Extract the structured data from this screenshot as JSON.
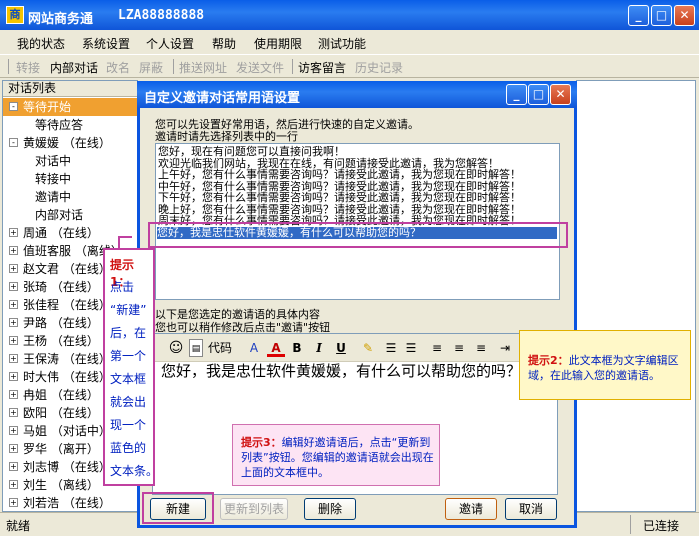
{
  "window": {
    "title": "网站商务通",
    "account": "LZA88888888",
    "icon_letter": "商"
  },
  "menu": [
    "我的状态",
    "系统设置",
    "个人设置",
    "帮助",
    "使用期限",
    "测试功能"
  ],
  "toolbar": {
    "transfer": "转接",
    "internal_chat": "内部对话",
    "rename": "改名",
    "block": "屏蔽",
    "push_url": "推送网址",
    "send_file": "发送文件",
    "visitor_msg": "访客留言",
    "history": "历史记录"
  },
  "left_panel": {
    "header": "对话列表",
    "rows": [
      {
        "exp": "-",
        "label": "等待开始",
        "kind": "sel"
      },
      {
        "exp": "",
        "label": "等待应答",
        "kind": "sub"
      },
      {
        "exp": "-",
        "label": "黄媛媛 （在线）",
        "kind": "sub"
      },
      {
        "exp": "",
        "label": "对话中",
        "kind": "sub"
      },
      {
        "exp": "",
        "label": "转接中",
        "kind": "sub"
      },
      {
        "exp": "",
        "label": "邀请中",
        "kind": "sub"
      },
      {
        "exp": "",
        "label": "内部对话",
        "kind": "sub"
      },
      {
        "exp": "+",
        "label": "周通 （在线）",
        "kind": "sub"
      },
      {
        "exp": "+",
        "label": "值班客服 （离线）",
        "kind": "sub"
      },
      {
        "exp": "+",
        "label": "赵文君 （在线）",
        "kind": "sub"
      },
      {
        "exp": "+",
        "label": "张琦 （在线）",
        "kind": "sub"
      },
      {
        "exp": "+",
        "label": "张佳程 （在线）",
        "kind": "sub"
      },
      {
        "exp": "+",
        "label": "尹路 （在线）",
        "kind": "sub"
      },
      {
        "exp": "+",
        "label": "王杨 （在线）",
        "kind": "sub"
      },
      {
        "exp": "+",
        "label": "王保涛 （在线）",
        "kind": "sub"
      },
      {
        "exp": "+",
        "label": "时大伟 （在线）",
        "kind": "sub"
      },
      {
        "exp": "+",
        "label": "冉姐 （在线）",
        "kind": "sub"
      },
      {
        "exp": "+",
        "label": "欧阳 （在线）",
        "kind": "sub"
      },
      {
        "exp": "+",
        "label": "马姐 （对话中）",
        "kind": "sub"
      },
      {
        "exp": "+",
        "label": "罗华 （离开）",
        "kind": "sub"
      },
      {
        "exp": "+",
        "label": "刘志博 （在线）",
        "kind": "sub"
      },
      {
        "exp": "+",
        "label": "刘生 （离线）",
        "kind": "sub"
      },
      {
        "exp": "+",
        "label": "刘若浩 （在线）",
        "kind": "sub"
      }
    ]
  },
  "status": {
    "left": "就绪",
    "right": "已连接"
  },
  "dialog": {
    "title": "自定义邀请对话常用语设置",
    "desc1": "您可以先设置好常用语，然后进行快速的自定义邀请。",
    "desc2": "邀请时请先选择列表中的一行",
    "list": [
      "您好，现在有问题您可以直接问我啊！",
      "欢迎光临我们网站，我现在在线，有问题请接受此邀请，我为您解答！",
      "上午好，您有什么事情需要咨询吗？请接受此邀请，我为您现在即时解答！",
      "中午好，您有什么事情需要咨询吗？请接受此邀请，我为您现在即时解答！",
      "下午好，您有什么事情需要咨询吗？请接受此邀请，我为您现在即时解答！",
      "晚上好，您有什么事情需要咨询吗？请接受此邀请，我为您现在即时解答！",
      "周末好，您有什么事情需要咨询吗？请接受此邀请，我为您现在即时解答！",
      "您好，我是忠仕软件黄媛媛，有什么可以帮助您的吗？"
    ],
    "selected_index": 7,
    "below1": "以下是您选定的邀请语的具体内容",
    "below2": "您也可以稍作修改后点击\"邀请\"按钮",
    "editor_code_label": "代码",
    "editor_text": "您好，我是忠仕软件黄媛媛，有什么可以帮助您的吗？",
    "buttons": {
      "new": "新建",
      "update": "更新到列表",
      "delete": "删除",
      "invite": "邀请",
      "cancel": "取消"
    }
  },
  "tips": {
    "tip1_title": "提示1：",
    "tip1_lines": [
      "点击",
      "“新建”",
      "后，在",
      "第一个",
      "文本框",
      "就会出",
      "现一个",
      "蓝色的",
      "文本条。"
    ],
    "tip2_title": "提示2：",
    "tip2_body": "此文本框为文字编辑区域，在此输入您的邀请语。",
    "tip3_title": "提示3：",
    "tip3_body": "编辑好邀请语后，点击“更新到列表”按钮。您编辑的邀请语就会出现在上面的文本框中。"
  },
  "colors": {
    "title_blue": "#0a5ee8",
    "selection": "#316ac5",
    "highlight_orange": "#f0a030",
    "tip_magenta": "#c040a0"
  }
}
